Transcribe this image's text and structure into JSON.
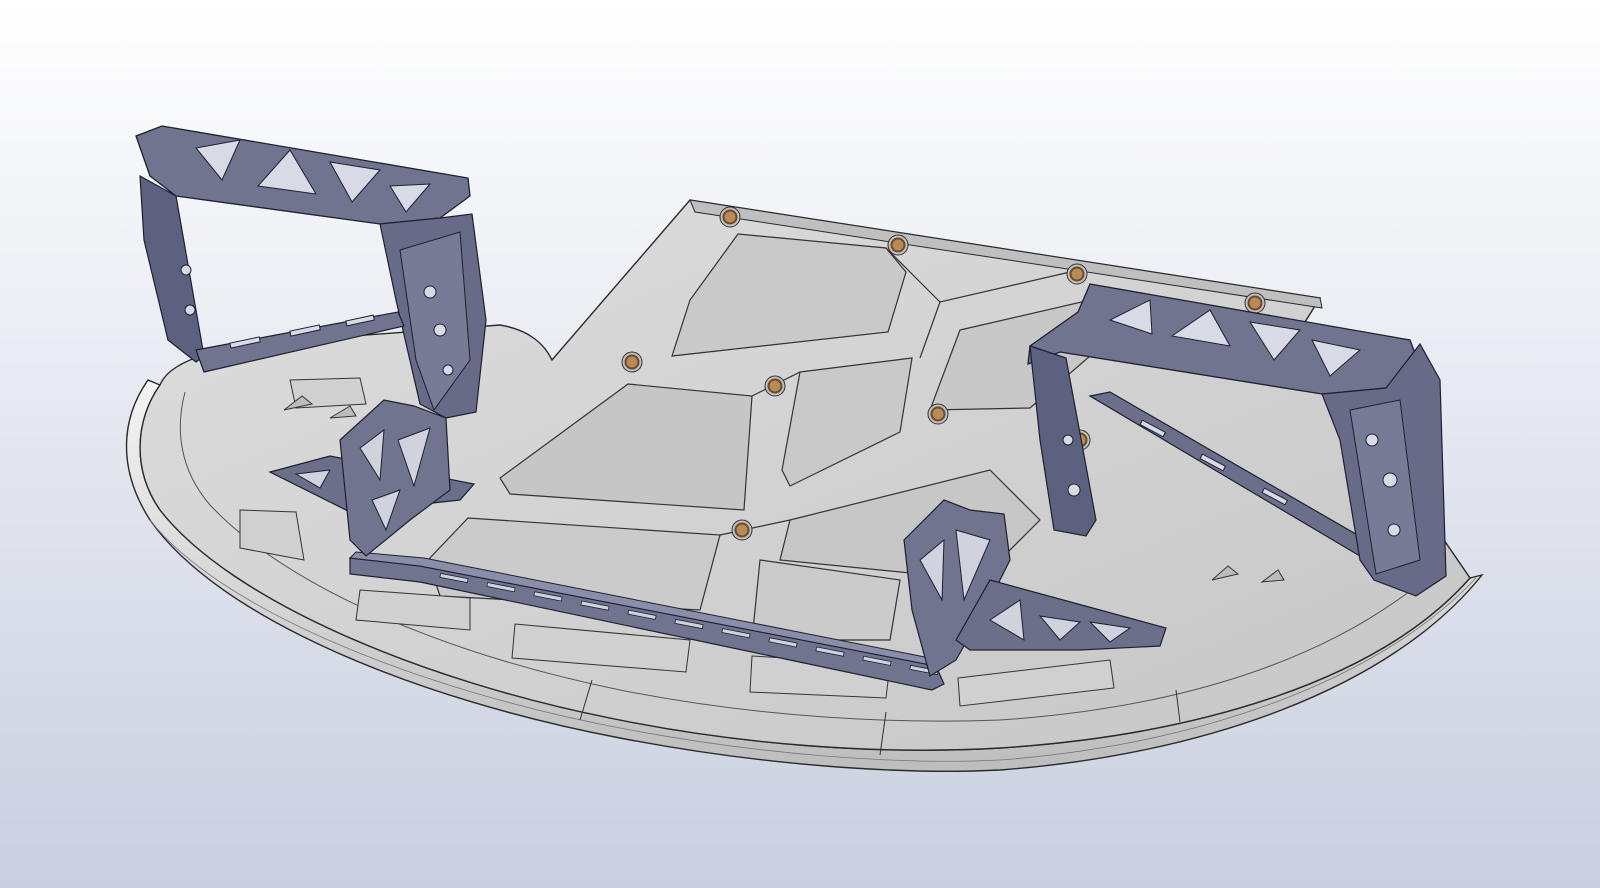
{
  "viewport": {
    "background_top": "#ffffff",
    "background_bottom": "#c9cfe0"
  },
  "model": {
    "panel_fill": "#d2d2d2",
    "panel_fill_light": "#e4e4e4",
    "panel_edge": "#2a2a2a",
    "lip_fill": "#dcdcdc",
    "frame_fill": "#70748e",
    "frame_dark": "#4a4d66",
    "frame_edge": "#1e2030",
    "fastener_outer": "#6b4a2c",
    "fastener_inner": "#b98a55",
    "components": [
      "undertray-panel",
      "left-mounting-frame",
      "right-mounting-frame",
      "left-corner-bracket",
      "right-corner-bracket",
      "front-crossbar",
      "fasteners"
    ]
  }
}
